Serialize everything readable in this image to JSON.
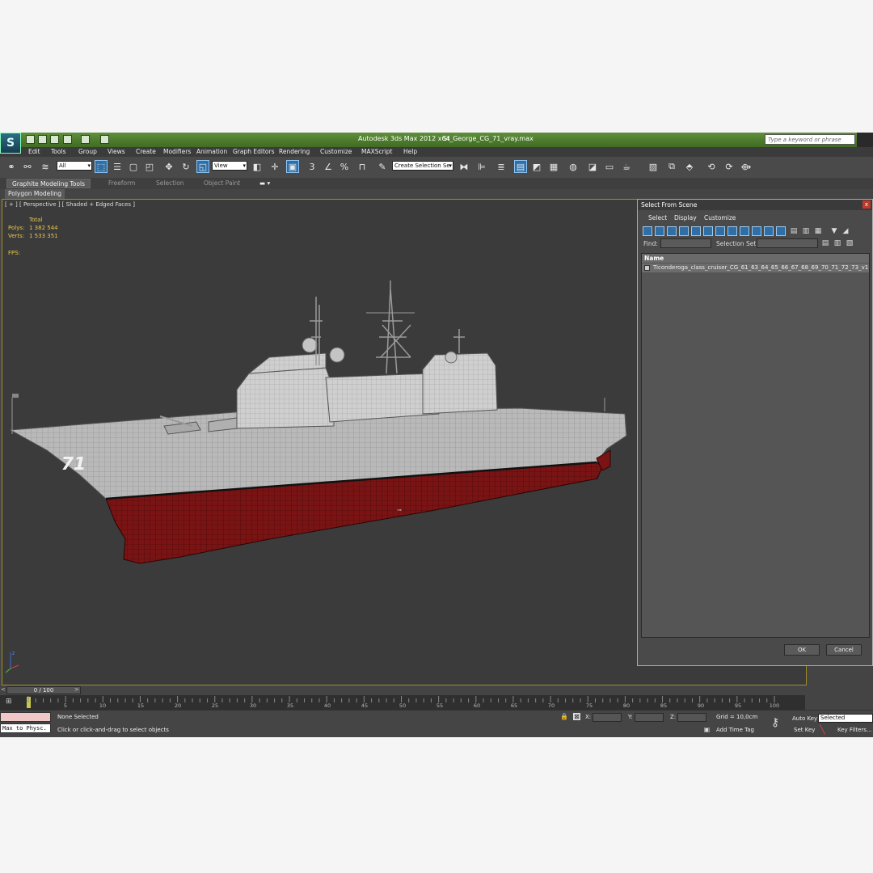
{
  "app": {
    "logo": "S",
    "title": "Autodesk 3ds Max  2012 x64",
    "file": "St_George_CG_71_vray.max",
    "search_placeholder": "Type a keyword or phrase"
  },
  "menu": [
    "Edit",
    "Tools",
    "Group",
    "Views",
    "Create",
    "Modifiers",
    "Animation",
    "Graph Editors",
    "Rendering",
    "Customize",
    "MAXScript",
    "Help"
  ],
  "toolbar": {
    "filter_value": "All",
    "ref_coord_value": "View",
    "snap_label": "3",
    "angle_snap_label": "%",
    "selection_set_value": "Create Selection Se"
  },
  "ribbon": {
    "tabs": [
      "Graphite Modeling Tools",
      "Freeform",
      "Selection",
      "Object Paint"
    ],
    "subtab": "Polygon Modeling"
  },
  "viewport": {
    "label": "[ + ] [ Perspective ] [ Shaded + Edged Faces ]",
    "stats": {
      "total_label": "Total",
      "polys_label": "Polys:",
      "polys_value": "1 382 544",
      "verts_label": "Verts:",
      "verts_value": "1 533 351",
      "fps_label": "FPS:"
    },
    "hull_number": "71"
  },
  "dialog": {
    "title": "Select From Scene",
    "close": "x",
    "menus": [
      "Select",
      "Display",
      "Customize"
    ],
    "find_label": "Find:",
    "selection_set_label": "Selection Set:",
    "list_header": "Name",
    "items": [
      "Ticonderoga_class_cruiser_CG_61_63_64_65_66_67_68_69_70_71_72_73_v1"
    ],
    "ok_label": "OK",
    "cancel_label": "Cancel"
  },
  "timeline": {
    "slider_label": "0 / 100",
    "ticks": [
      "5",
      "10",
      "15",
      "20",
      "25",
      "30",
      "35",
      "40",
      "45",
      "50",
      "55",
      "60",
      "65",
      "70",
      "75",
      "80",
      "85",
      "90",
      "95",
      "100"
    ]
  },
  "status": {
    "selection": "None Selected",
    "prompt": "Click or click-and-drag to select objects",
    "listener_text": "Max to Physc.",
    "x_label": "X:",
    "y_label": "Y:",
    "z_label": "Z:",
    "grid": "Grid = 10,0cm",
    "add_time_tag": "Add Time Tag",
    "auto_key": "Auto Key",
    "set_key": "Set Key",
    "key_mode_value": "Selected",
    "key_filters": "Key Filters..."
  }
}
